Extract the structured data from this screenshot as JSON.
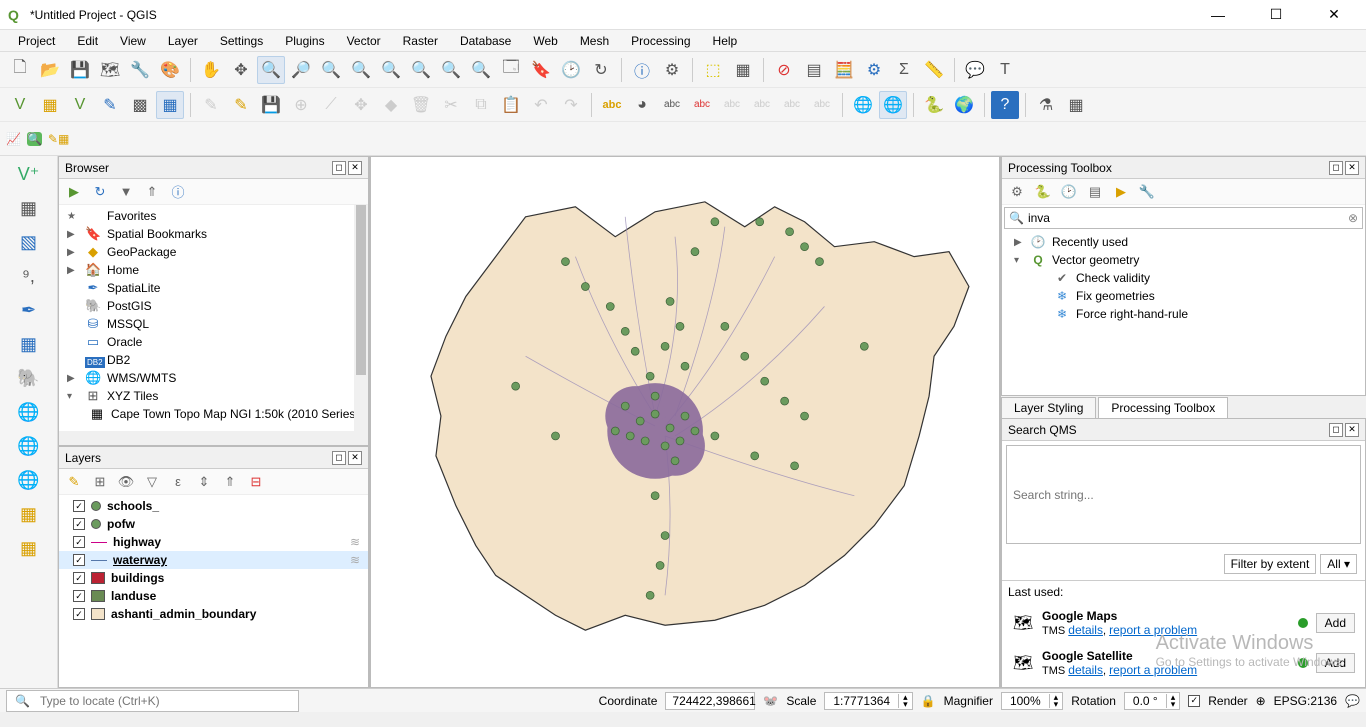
{
  "title": "*Untitled Project - QGIS",
  "menus": [
    "Project",
    "Edit",
    "View",
    "Layer",
    "Settings",
    "Plugins",
    "Vector",
    "Raster",
    "Database",
    "Web",
    "Mesh",
    "Processing",
    "Help"
  ],
  "browser": {
    "title": "Browser",
    "items": [
      {
        "icon": "★",
        "label": "Favorites",
        "color": "#e6b800"
      },
      {
        "icon": "▶",
        "sub": "🔖",
        "label": "Spatial Bookmarks"
      },
      {
        "icon": "▶",
        "sub": "◆",
        "label": "GeoPackage",
        "color": "#d9a000"
      },
      {
        "icon": "▶",
        "sub": "🏠",
        "label": "Home"
      },
      {
        "icon": "",
        "sub": "✒",
        "label": "SpatiaLite",
        "color": "#2a6fbf"
      },
      {
        "icon": "",
        "sub": "🐘",
        "label": "PostGIS",
        "color": "#2a6fbf"
      },
      {
        "icon": "",
        "sub": "⛁",
        "label": "MSSQL",
        "color": "#2a6fbf"
      },
      {
        "icon": "",
        "sub": "▭",
        "label": "Oracle",
        "color": "#2a6fbf"
      },
      {
        "icon": "",
        "sub": "DB2",
        "label": "DB2",
        "badge": true
      },
      {
        "icon": "▶",
        "sub": "🌐",
        "label": "WMS/WMTS"
      },
      {
        "icon": "▾",
        "sub": "⊞",
        "label": "XYZ Tiles"
      }
    ],
    "child": "Cape Town Topo Map NGI 1:50k (2010 Series"
  },
  "layers": {
    "title": "Layers",
    "items": [
      {
        "type": "pt",
        "label": "schools_"
      },
      {
        "type": "pt",
        "label": "pofw"
      },
      {
        "type": "line-pink",
        "label": "highway",
        "squiggle": true
      },
      {
        "type": "line-blue",
        "label": "waterway",
        "selected": true,
        "squiggle": true
      },
      {
        "type": "red",
        "label": "buildings"
      },
      {
        "type": "green",
        "label": "landuse"
      },
      {
        "type": "beige",
        "label": "ashanti_admin_boundary"
      }
    ]
  },
  "processing": {
    "title": "Processing Toolbox",
    "search": "inva",
    "tree": [
      {
        "level": 1,
        "icon": "▶",
        "sym": "🕑",
        "label": "Recently used"
      },
      {
        "level": 1,
        "icon": "▾",
        "sym": "Q",
        "label": "Vector geometry",
        "q": true
      },
      {
        "level": 2,
        "icon": "",
        "sym": "✔",
        "label": "Check validity"
      },
      {
        "level": 2,
        "icon": "",
        "sym": "❄",
        "label": "Fix geometries",
        "blue": true
      },
      {
        "level": 2,
        "icon": "",
        "sym": "❄",
        "label": "Force right-hand-rule",
        "blue": true
      }
    ],
    "tabs": [
      "Layer Styling",
      "Processing Toolbox"
    ],
    "tabActive": 1
  },
  "qms": {
    "title": "Search QMS",
    "placeholder": "Search string...",
    "filter": "Filter by extent",
    "all": "All",
    "last": "Last used:",
    "items": [
      {
        "name": "Google Maps",
        "sub": "TMS",
        "l1": "details",
        "l2": "report a problem"
      },
      {
        "name": "Google Satellite",
        "sub": "TMS",
        "l1": "details",
        "l2": "report a problem"
      }
    ],
    "add": "Add"
  },
  "watermark": {
    "w1": "Activate Windows",
    "w2": "Go to Settings to activate Windows."
  },
  "status": {
    "locator": "Type to locate (Ctrl+K)",
    "coord_lbl": "Coordinate",
    "coord": "724422,398661",
    "scale_lbl": "Scale",
    "scale": "1:7771364",
    "mag_lbl": "Magnifier",
    "mag": "100%",
    "rot_lbl": "Rotation",
    "rot": "0.0 °",
    "render": "Render",
    "crs": "EPSG:2136"
  }
}
